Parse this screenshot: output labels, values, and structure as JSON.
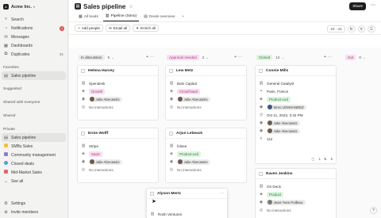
{
  "workspace": {
    "name": "Acme Inc.",
    "logo": "A"
  },
  "sidebar": {
    "top_items": [
      {
        "label": "Search",
        "icon": "search-icon"
      },
      {
        "label": "Notifications",
        "icon": "bell-icon",
        "badge": "4"
      },
      {
        "label": "Messages",
        "icon": "mail-icon"
      },
      {
        "label": "Dashboards",
        "icon": "dashboard-icon"
      },
      {
        "label": "Duplicates",
        "icon": "duplicates-icon",
        "count": "91"
      }
    ],
    "favorites_title": "Favorites",
    "favorites": [
      {
        "label": "Sales pipeline"
      }
    ],
    "suggested_title": "Suggested",
    "shared_everyone_title": "Shared with everyone",
    "shared_title": "Shared",
    "private_title": "Private",
    "private_items": [
      {
        "label": "Sales pipeline",
        "color": "#2b2b2b"
      },
      {
        "label": "SMBs Sales",
        "color": "#f1c232"
      },
      {
        "label": "Community management",
        "color": "#8e7cc3"
      },
      {
        "label": "Closed deals",
        "color": "#5b9bd5"
      },
      {
        "label": "Mid-Market Sales",
        "color": "#e06666"
      }
    ],
    "see_all": "See all",
    "settings": "Settings",
    "invite": "Invite members"
  },
  "header": {
    "title": "Sales pipeline",
    "share_label": "Share",
    "more": "⋯"
  },
  "tabs": [
    {
      "label": "All leads",
      "icon": "table-icon"
    },
    {
      "label": "Pipeline (Simo)",
      "icon": "kanban-icon",
      "active": true
    },
    {
      "label": "Deals overview",
      "icon": "chart-icon"
    },
    {
      "label": "+"
    }
  ],
  "toolbar": {
    "add_people": "Add people",
    "email_all": "Email all",
    "enrich_all": "Enrich all",
    "count_label": "10 · 41"
  },
  "columns": [
    {
      "status": "In discussion",
      "count": "6",
      "bg": "#ececeb",
      "fg": "#333333"
    },
    {
      "status": "Approval needed",
      "count": "2",
      "bg": "#f7dff0",
      "fg": "#b03a88"
    },
    {
      "status": "Closed",
      "count": "12",
      "bg": "#dff4e0",
      "fg": "#2f7d37"
    },
    {
      "status": "Out",
      "count": "0",
      "bg": "#f7dff0",
      "fg": "#b03a88"
    }
  ],
  "cards": {
    "helena": {
      "name": "Helena Harvey",
      "company": "Spendesk",
      "tag": "Growth",
      "owner": "Julie Abecassis",
      "interactions": "No interactions"
    },
    "lew": {
      "name": "Lew Metz",
      "company": "Bain Capital",
      "tag": "Cloud/SaaS",
      "owner": "Julie Abecassis",
      "interactions": "No interactions"
    },
    "connie": {
      "name": "Connie Mills",
      "company": "General Catalyst",
      "location": "Paris, France",
      "tag": "Product-Led",
      "owner": "Simo LEMHANDEZ",
      "date": "Oct 11, 2023, 3:42 PM",
      "owner2": "Julie Abecassis",
      "owner3": "Julie Abecassis",
      "num": "112",
      "foot1": "1",
      "foot2": "6"
    },
    "ernie": {
      "name": "Ernie Wolff",
      "company": "Stripe",
      "tag": "SaaS",
      "owner": "Julie Abecassis",
      "interactions": "No interactions"
    },
    "arjun": {
      "name": "Arjun Lebeack",
      "company": "folsee",
      "tag": "Product-Led",
      "owner": "Julie Abecassis",
      "interactions": "No interactions"
    },
    "alyson": {
      "name": "Alyson Mertz",
      "company": "Rosh Ventures"
    },
    "raven": {
      "name": "Raven Jenkins",
      "company": "On Deck",
      "tag": "Product",
      "owner": "Jean-Yves Poilleux",
      "interactions": "No interactions"
    }
  },
  "help": "?"
}
